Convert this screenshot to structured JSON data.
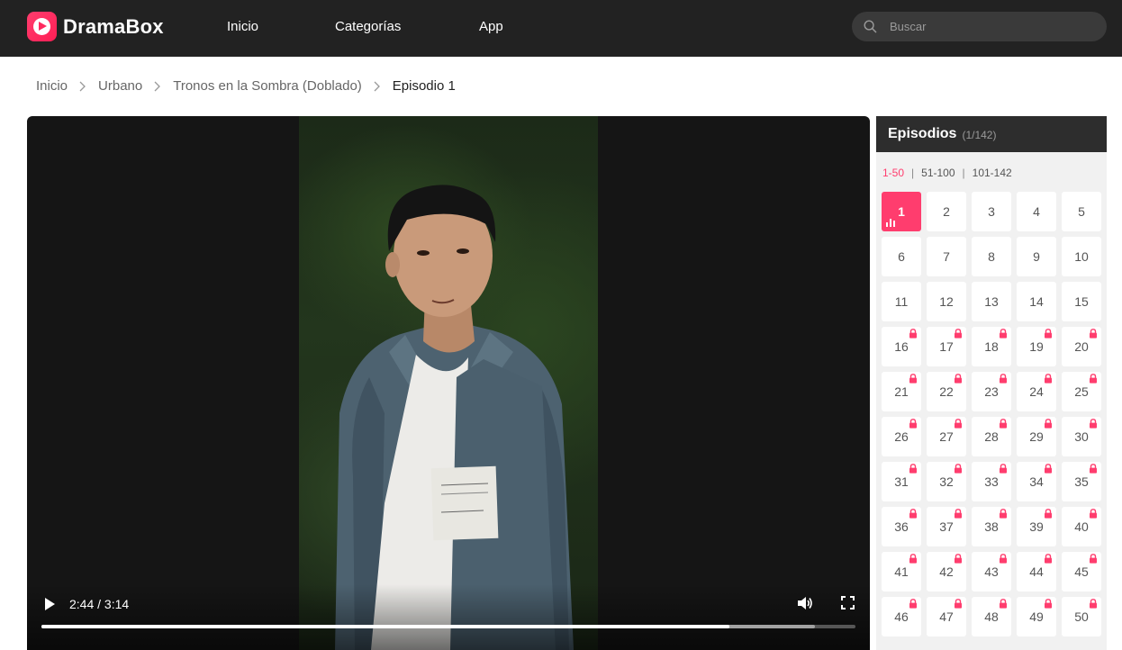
{
  "header": {
    "brand": "DramaBox",
    "nav": [
      {
        "label": "Inicio"
      },
      {
        "label": "Categorías"
      },
      {
        "label": "App"
      }
    ],
    "search_placeholder": "Buscar"
  },
  "breadcrumb": [
    {
      "label": "Inicio"
    },
    {
      "label": "Urbano"
    },
    {
      "label": "Tronos en la Sombra (Doblado)"
    },
    {
      "label": "Episodio 1"
    }
  ],
  "player": {
    "time": "2:44 / 3:14",
    "progress": 0.845,
    "buffered": 0.95
  },
  "episodes": {
    "title": "Episodios",
    "count": "(1/142)",
    "ranges": [
      {
        "label": "1-50",
        "active": true
      },
      {
        "label": "51-100",
        "active": false
      },
      {
        "label": "101-142",
        "active": false
      }
    ],
    "current": 1,
    "free_until": 15,
    "list": [
      "1",
      "2",
      "3",
      "4",
      "5",
      "6",
      "7",
      "8",
      "9",
      "10",
      "11",
      "12",
      "13",
      "14",
      "15",
      "16",
      "17",
      "18",
      "19",
      "20",
      "21",
      "22",
      "23",
      "24",
      "25",
      "26",
      "27",
      "28",
      "29",
      "30",
      "31",
      "32",
      "33",
      "34",
      "35",
      "36",
      "37",
      "38",
      "39",
      "40",
      "41",
      "42",
      "43",
      "44",
      "45",
      "46",
      "47",
      "48",
      "49",
      "50"
    ]
  },
  "colors": {
    "accent": "#ff3d6e",
    "header_bg": "#222222"
  }
}
